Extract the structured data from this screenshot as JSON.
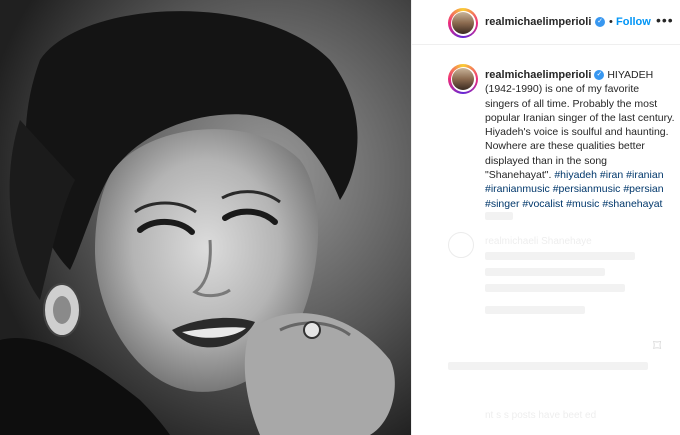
{
  "header": {
    "username": "realmichaelimperioli",
    "dot": "•",
    "follow_label": "Follow",
    "more_icon": "•••"
  },
  "caption": {
    "username": "realmichaelimperioli",
    "text": "HIYADEH (1942-1990) is one of my favorite singers of all time. Probably the most popular Iranian singer of the last century. Hiyadeh's voice is soulful and haunting. Nowhere are these qualities better displayed than in the song \"Shanehayat\".",
    "hashtags": [
      "#hiyadeh",
      "#iran",
      "#iranian",
      "#iranianmusic",
      "#persianmusic",
      "#persian",
      "#singer",
      "#vocalist",
      "#music",
      "#shanehayat"
    ]
  },
  "faded": {
    "comment_user": "realmichaeli",
    "comment_text": "Shanehaye",
    "footer_text": "nt  s  s  posts have beet  ed"
  },
  "icons": {
    "verified": "verified-badge-icon",
    "bookmark": "bookmark-icon",
    "more": "more-options-icon"
  },
  "colors": {
    "follow": "#0095f6",
    "hashtag": "#00376b",
    "verified": "#3897f0",
    "text": "#262626"
  }
}
